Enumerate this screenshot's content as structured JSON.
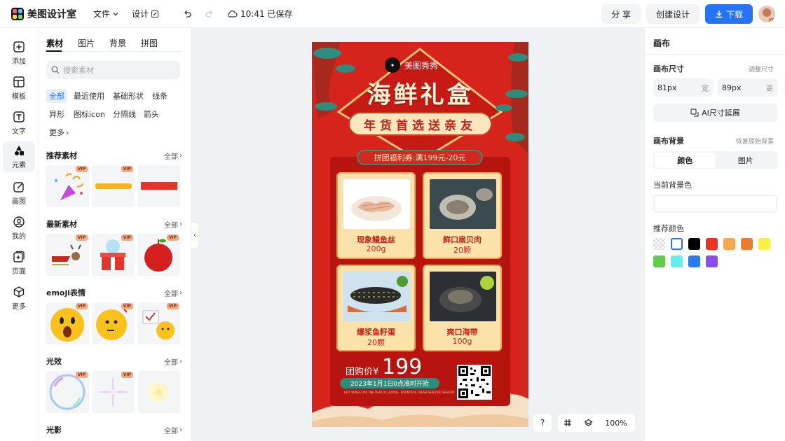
{
  "app": {
    "title": "美图设计室"
  },
  "header": {
    "file_menu": "文件",
    "design_menu": "设计",
    "saved_status": "10:41 已保存",
    "share": "分 享",
    "create": "创建设计",
    "download": "下载",
    "avatar_badge": "VIP"
  },
  "rail": {
    "items": [
      {
        "label": "添加",
        "icon": "plus-square-icon"
      },
      {
        "label": "模板",
        "icon": "template-icon"
      },
      {
        "label": "文字",
        "icon": "text-icon"
      },
      {
        "label": "元素",
        "icon": "shapes-icon"
      },
      {
        "label": "画图",
        "icon": "pen-icon"
      },
      {
        "label": "我的",
        "icon": "user-icon"
      },
      {
        "label": "页面",
        "icon": "page-add-icon"
      },
      {
        "label": "更多",
        "icon": "cube-icon"
      }
    ],
    "active": "元素"
  },
  "panel": {
    "tabs": [
      "素材",
      "图片",
      "背景",
      "拼图"
    ],
    "search_placeholder": "搜索素材",
    "chips": [
      "全部",
      "最近使用",
      "基础形状",
      "线条",
      "异形",
      "图标icon",
      "分隔线",
      "箭头",
      "更多"
    ],
    "all_label": "全部",
    "vip_label": "VIP",
    "sections": [
      {
        "title": "推荐素材"
      },
      {
        "title": "最新素材"
      },
      {
        "title": "emoji表情"
      },
      {
        "title": "光效"
      },
      {
        "title": "光影"
      }
    ]
  },
  "poster": {
    "brand": "美图秀秀",
    "title": "海鲜礼盒",
    "subtitle": "年货首选送亲友",
    "coupon": "拼团福利券:满199元-20元",
    "products": [
      {
        "name": "现象鳗鱼丝",
        "qty": "200g"
      },
      {
        "name": "鲜口扇贝肉",
        "qty": "20颗"
      },
      {
        "name": "爆浆鱼籽蛋",
        "qty": "20颗"
      },
      {
        "name": "爽口海带",
        "qty": "100g"
      }
    ],
    "price_label": "团购价¥",
    "price_value": "199",
    "date": "2023年1月1日0点准时开抢",
    "fine_print": "GIFT BOXES FOR THE YEAR OF GOODS · BOUNTIFUL FRESH SEAFOOD SEASON",
    "colors": {
      "red": "#d6231c",
      "cream": "#fbe2a9",
      "teal": "#2f8b7b"
    }
  },
  "zoom": {
    "help": "?",
    "level": "100%"
  },
  "right": {
    "title": "画布",
    "size_label": "画布尺寸",
    "size_link": "调整尺寸",
    "width_value": "81px",
    "width_unit": "宽",
    "height_value": "89px",
    "height_unit": "高",
    "ai_button": "AI尺寸延展",
    "bg_label": "画布背景",
    "bg_link": "恢复原始背景",
    "seg_color": "颜色",
    "seg_image": "图片",
    "current_label": "当前背景色",
    "recommend_label": "推荐颜色",
    "swatches": [
      "transparent",
      "#ffffff",
      "#000000",
      "#ea3323",
      "#f2a84e",
      "#ee7b2c",
      "#f7f04a",
      "#5fcc4a",
      "#5ff0ee",
      "#2a7df0",
      "#8e4cf0"
    ]
  }
}
